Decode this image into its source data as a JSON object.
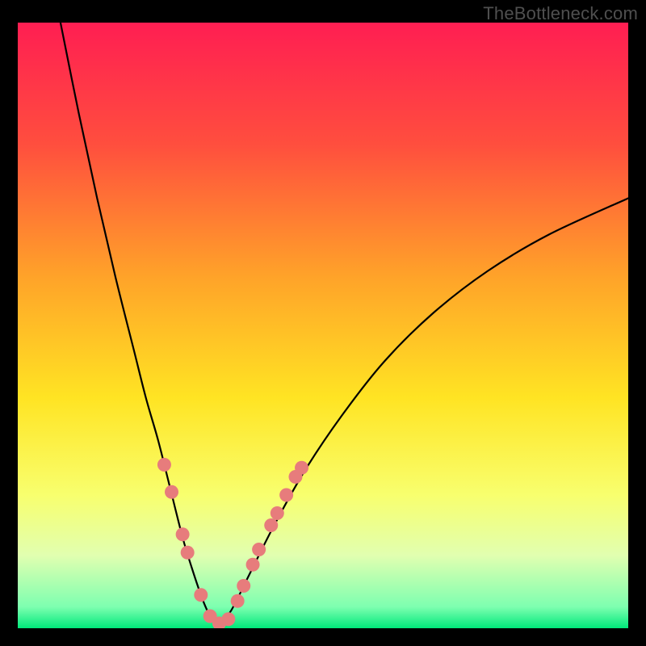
{
  "watermark": "TheBottleneck.com",
  "chart_data": {
    "type": "line",
    "title": "",
    "xlabel": "",
    "ylabel": "",
    "xlim": [
      0,
      100
    ],
    "ylim": [
      0,
      100
    ],
    "background_gradient": {
      "stops": [
        {
          "offset": 0.0,
          "color": "#ff1e52"
        },
        {
          "offset": 0.2,
          "color": "#ff4e3e"
        },
        {
          "offset": 0.42,
          "color": "#ffa329"
        },
        {
          "offset": 0.62,
          "color": "#ffe423"
        },
        {
          "offset": 0.78,
          "color": "#f8ff6e"
        },
        {
          "offset": 0.88,
          "color": "#e1ffb0"
        },
        {
          "offset": 0.965,
          "color": "#7dffb0"
        },
        {
          "offset": 1.0,
          "color": "#00e87a"
        }
      ]
    },
    "series": [
      {
        "name": "left-branch",
        "type": "curve",
        "stroke": "#000000",
        "stroke_width": 2.2,
        "x": [
          7,
          10,
          13,
          16,
          19,
          21,
          23,
          25,
          27,
          28.5,
          30,
          31,
          32,
          33
        ],
        "y": [
          100,
          85,
          71,
          58,
          46,
          38,
          31,
          23,
          15,
          10,
          5.5,
          3,
          1.2,
          0.5
        ]
      },
      {
        "name": "right-branch",
        "type": "curve",
        "stroke": "#000000",
        "stroke_width": 2.2,
        "x": [
          33,
          35,
          38,
          42,
          47,
          53,
          60,
          68,
          77,
          87,
          100
        ],
        "y": [
          0.5,
          3,
          9,
          17,
          26,
          35,
          44,
          52,
          59,
          65,
          71
        ]
      }
    ],
    "scatter": {
      "color": "#e77c7c",
      "radius": 8.5,
      "points": [
        {
          "x": 24.0,
          "y": 27.0
        },
        {
          "x": 25.2,
          "y": 22.5
        },
        {
          "x": 27.0,
          "y": 15.5
        },
        {
          "x": 27.8,
          "y": 12.5
        },
        {
          "x": 30.0,
          "y": 5.5
        },
        {
          "x": 31.5,
          "y": 2.0
        },
        {
          "x": 33.0,
          "y": 0.8
        },
        {
          "x": 34.5,
          "y": 1.5
        },
        {
          "x": 36.0,
          "y": 4.5
        },
        {
          "x": 37.0,
          "y": 7.0
        },
        {
          "x": 38.5,
          "y": 10.5
        },
        {
          "x": 39.5,
          "y": 13.0
        },
        {
          "x": 41.5,
          "y": 17.0
        },
        {
          "x": 42.5,
          "y": 19.0
        },
        {
          "x": 44.0,
          "y": 22.0
        },
        {
          "x": 45.5,
          "y": 25.0
        },
        {
          "x": 46.5,
          "y": 26.5
        }
      ]
    }
  }
}
